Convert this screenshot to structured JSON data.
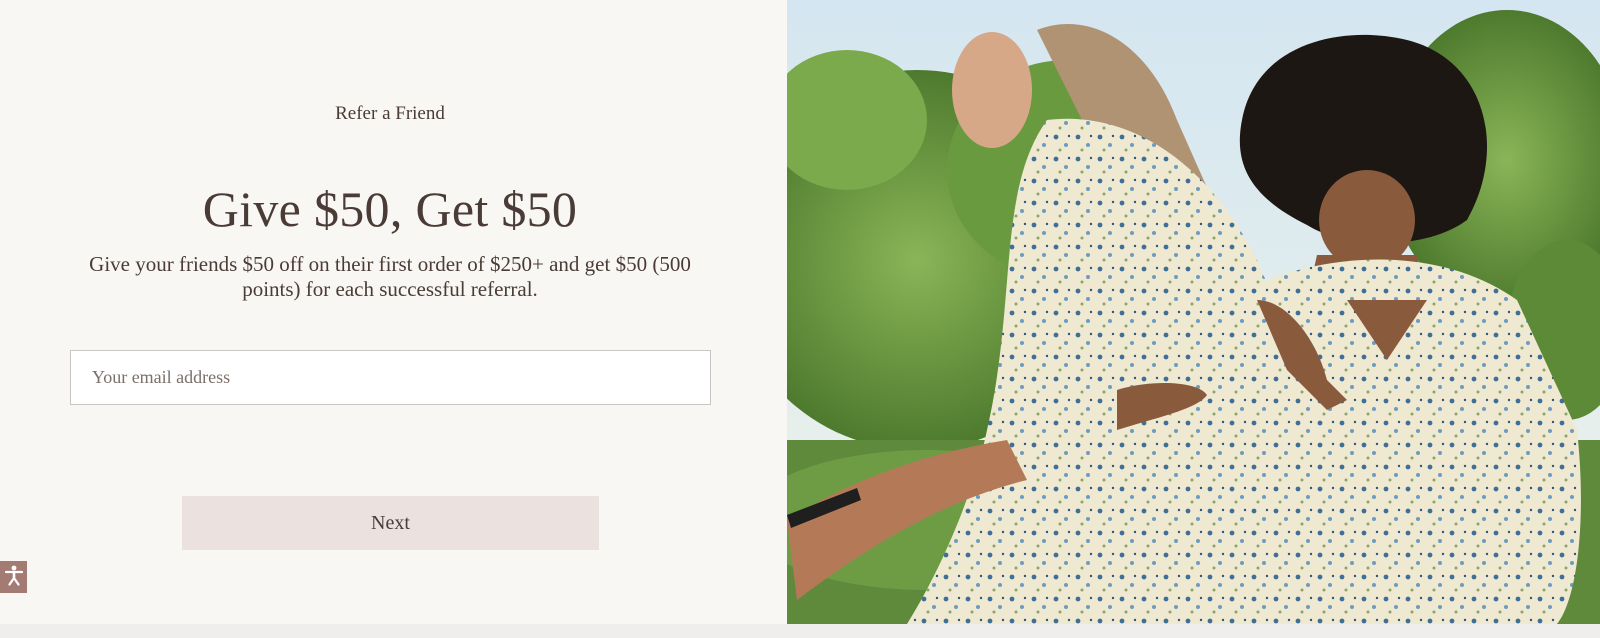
{
  "referral": {
    "eyebrow": "Refer a Friend",
    "headline": "Give $50, Get $50",
    "description": "Give your friends $50 off on their first order of $250+ and get $50 (500 points) for each successful referral.",
    "email_placeholder": "Your email address",
    "next_label": "Next"
  },
  "icons": {
    "accessibility": "accessibility-icon"
  },
  "colors": {
    "panel_background": "#f9f7f4",
    "text": "#4a3b36",
    "button_background": "#ebe2e0",
    "accessibility_badge": "#a47b72"
  }
}
